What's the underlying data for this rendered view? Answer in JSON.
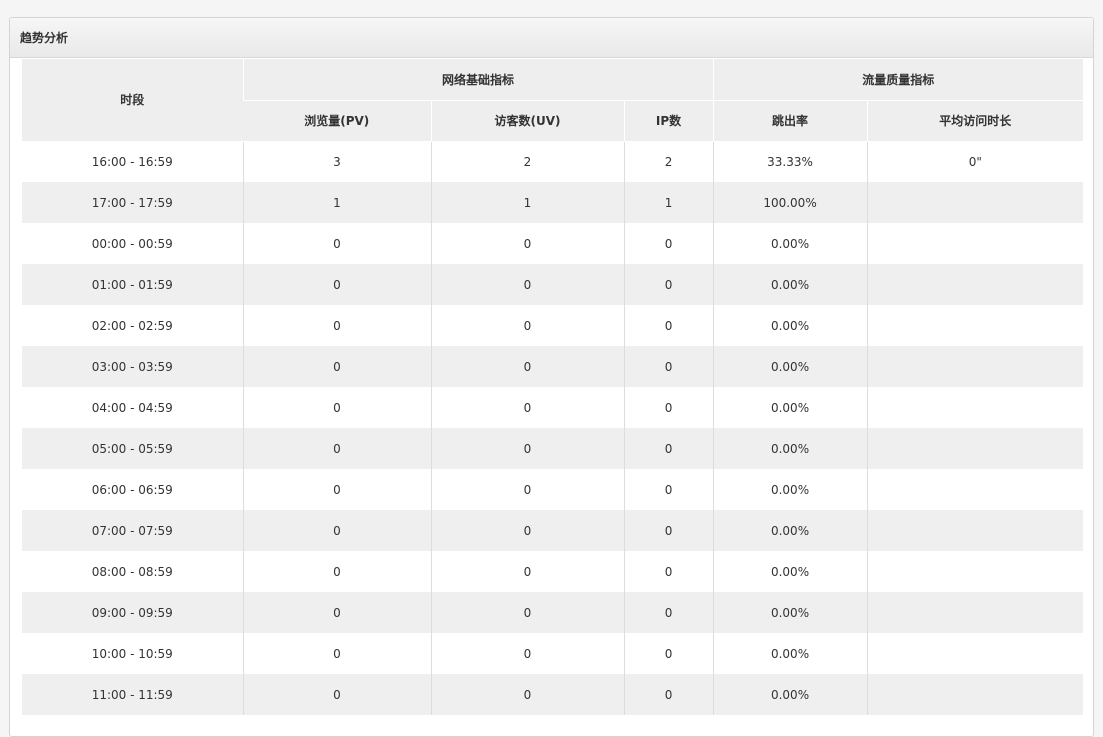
{
  "panel": {
    "title": "趋势分析"
  },
  "table": {
    "group_headers": {
      "period": "时段",
      "network": "网络基础指标",
      "quality": "流量质量指标"
    },
    "columns": {
      "pv": "浏览量(PV)",
      "uv": "访客数(UV)",
      "ip": "IP数",
      "bounce": "跳出率",
      "avg_duration": "平均访问时长"
    },
    "rows": [
      {
        "period": "16:00 - 16:59",
        "pv": "3",
        "uv": "2",
        "ip": "2",
        "bounce": "33.33%",
        "avg": "0\""
      },
      {
        "period": "17:00 - 17:59",
        "pv": "1",
        "uv": "1",
        "ip": "1",
        "bounce": "100.00%",
        "avg": ""
      },
      {
        "period": "00:00 - 00:59",
        "pv": "0",
        "uv": "0",
        "ip": "0",
        "bounce": "0.00%",
        "avg": ""
      },
      {
        "period": "01:00 - 01:59",
        "pv": "0",
        "uv": "0",
        "ip": "0",
        "bounce": "0.00%",
        "avg": ""
      },
      {
        "period": "02:00 - 02:59",
        "pv": "0",
        "uv": "0",
        "ip": "0",
        "bounce": "0.00%",
        "avg": ""
      },
      {
        "period": "03:00 - 03:59",
        "pv": "0",
        "uv": "0",
        "ip": "0",
        "bounce": "0.00%",
        "avg": ""
      },
      {
        "period": "04:00 - 04:59",
        "pv": "0",
        "uv": "0",
        "ip": "0",
        "bounce": "0.00%",
        "avg": ""
      },
      {
        "period": "05:00 - 05:59",
        "pv": "0",
        "uv": "0",
        "ip": "0",
        "bounce": "0.00%",
        "avg": ""
      },
      {
        "period": "06:00 - 06:59",
        "pv": "0",
        "uv": "0",
        "ip": "0",
        "bounce": "0.00%",
        "avg": ""
      },
      {
        "period": "07:00 - 07:59",
        "pv": "0",
        "uv": "0",
        "ip": "0",
        "bounce": "0.00%",
        "avg": ""
      },
      {
        "period": "08:00 - 08:59",
        "pv": "0",
        "uv": "0",
        "ip": "0",
        "bounce": "0.00%",
        "avg": ""
      },
      {
        "period": "09:00 - 09:59",
        "pv": "0",
        "uv": "0",
        "ip": "0",
        "bounce": "0.00%",
        "avg": ""
      },
      {
        "period": "10:00 - 10:59",
        "pv": "0",
        "uv": "0",
        "ip": "0",
        "bounce": "0.00%",
        "avg": ""
      },
      {
        "period": "11:00 - 11:59",
        "pv": "0",
        "uv": "0",
        "ip": "0",
        "bounce": "0.00%",
        "avg": ""
      }
    ]
  }
}
